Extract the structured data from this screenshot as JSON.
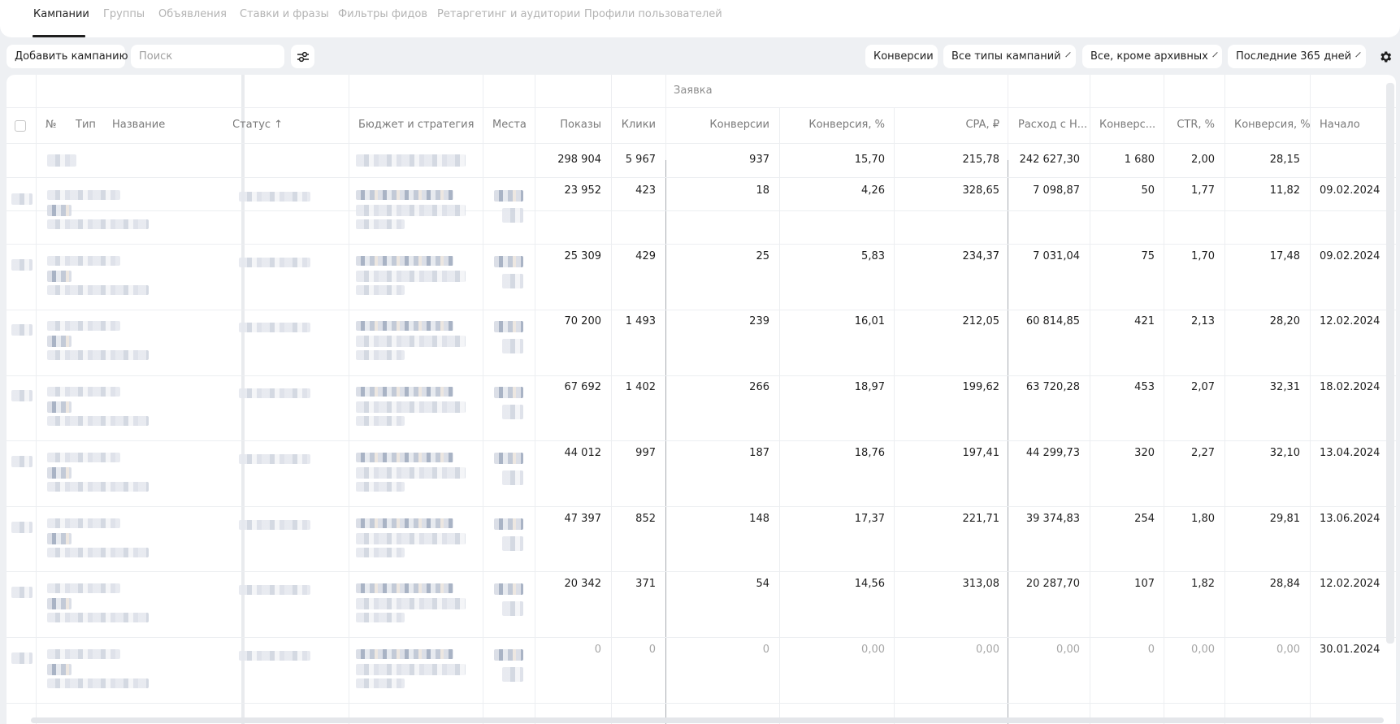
{
  "tabs": [
    {
      "label": "Кампании",
      "active": true
    },
    {
      "label": "Группы",
      "active": false
    },
    {
      "label": "Объявления",
      "active": false
    },
    {
      "label": "Ставки и фразы",
      "active": false
    },
    {
      "label": "Фильтры фидов",
      "active": false
    },
    {
      "label": "Ретаргетинг и аудитории",
      "active": false
    },
    {
      "label": "Профили пользователей",
      "active": false
    }
  ],
  "toolbar": {
    "add_campaign": "Добавить кампанию",
    "search_placeholder": "Поиск",
    "conversions": "Конверсии",
    "campaign_types": "Все типы кампаний",
    "archive_filter": "Все, кроме архивных",
    "period": "Последние 365 дней"
  },
  "table": {
    "group_header": "Заявка",
    "headers": {
      "num": "№",
      "type": "Тип",
      "name": "Название",
      "status": "Статус ↑",
      "budget": "Бюджет и стратегия",
      "places": "Места",
      "shows": "Показы",
      "clicks": "Клики",
      "conv": "Конверсии",
      "conv_pct": "Конверсия, %",
      "cpa": "CPA, ₽",
      "spend": "Расход с Н...",
      "conv2": "Конверс...",
      "ctr": "CTR, %",
      "conv_pct2": "Конверсия, %",
      "start": "Начало"
    },
    "total": {
      "shows": "298 904",
      "clicks": "5 967",
      "conv": "937",
      "conv_pct": "15,70",
      "cpa": "215,78",
      "spend": "242 627,30",
      "conv2": "1 680",
      "ctr": "2,00",
      "conv_pct2": "28,15",
      "start": ""
    },
    "rows": [
      {
        "shows": "23 952",
        "clicks": "423",
        "conv": "18",
        "conv_pct": "4,26",
        "cpa": "328,65",
        "spend": "7 098,87",
        "conv2": "50",
        "ctr": "1,77",
        "conv_pct2": "11,82",
        "start": "09.02.2024"
      },
      {
        "shows": "25 309",
        "clicks": "429",
        "conv": "25",
        "conv_pct": "5,83",
        "cpa": "234,37",
        "spend": "7 031,04",
        "conv2": "75",
        "ctr": "1,70",
        "conv_pct2": "17,48",
        "start": "09.02.2024"
      },
      {
        "shows": "70 200",
        "clicks": "1 493",
        "conv": "239",
        "conv_pct": "16,01",
        "cpa": "212,05",
        "spend": "60 814,85",
        "conv2": "421",
        "ctr": "2,13",
        "conv_pct2": "28,20",
        "start": "12.02.2024"
      },
      {
        "shows": "67 692",
        "clicks": "1 402",
        "conv": "266",
        "conv_pct": "18,97",
        "cpa": "199,62",
        "spend": "63 720,28",
        "conv2": "453",
        "ctr": "2,07",
        "conv_pct2": "32,31",
        "start": "18.02.2024"
      },
      {
        "shows": "44 012",
        "clicks": "997",
        "conv": "187",
        "conv_pct": "18,76",
        "cpa": "197,41",
        "spend": "44 299,73",
        "conv2": "320",
        "ctr": "2,27",
        "conv_pct2": "32,10",
        "start": "13.04.2024"
      },
      {
        "shows": "47 397",
        "clicks": "852",
        "conv": "148",
        "conv_pct": "17,37",
        "cpa": "221,71",
        "spend": "39 374,83",
        "conv2": "254",
        "ctr": "1,80",
        "conv_pct2": "29,81",
        "start": "13.06.2024"
      },
      {
        "shows": "20 342",
        "clicks": "371",
        "conv": "54",
        "conv_pct": "14,56",
        "cpa": "313,08",
        "spend": "20 287,70",
        "conv2": "107",
        "ctr": "1,82",
        "conv_pct2": "28,84",
        "start": "12.02.2024"
      },
      {
        "shows": "0",
        "clicks": "0",
        "conv": "0",
        "conv_pct": "0,00",
        "cpa": "0,00",
        "spend": "0,00",
        "conv2": "0",
        "ctr": "0,00",
        "conv_pct2": "0,00",
        "start": "30.01.2024",
        "zero": true
      }
    ]
  },
  "icons": {
    "filter": "sliders-icon",
    "settings": "gear-icon",
    "checkbox": "checkbox-icon"
  }
}
